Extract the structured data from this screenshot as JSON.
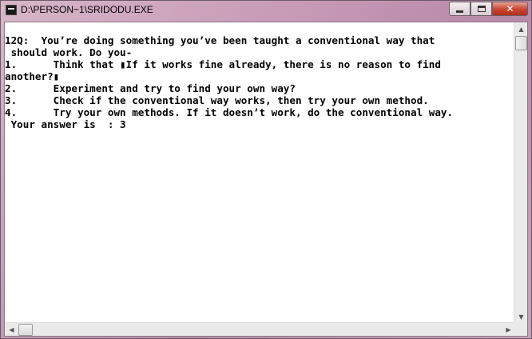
{
  "window": {
    "title": "D:\\PERSON~1\\SRIDODU.EXE",
    "minimize_icon": "minimize-icon",
    "maximize_icon": "maximize-icon",
    "close_icon": "close-icon",
    "close_label": "✕"
  },
  "console": {
    "lines": [
      "12Q:  You’re doing something you’ve been taught a conventional way that",
      " should work. Do you-",
      "1.      Think that ▮If it works fine already, there is no reason to find",
      "another?▮",
      "2.      Experiment and try to find your own way?",
      "3.      Check if the conventional way works, then try your own method.",
      "4.      Try your own methods. If it doesn’t work, do the conventional way.",
      " Your answer is  : 3"
    ]
  },
  "scrollbars": {
    "up_icon": "▲",
    "down_icon": "▼",
    "left_icon": "◀",
    "right_icon": "▶"
  }
}
